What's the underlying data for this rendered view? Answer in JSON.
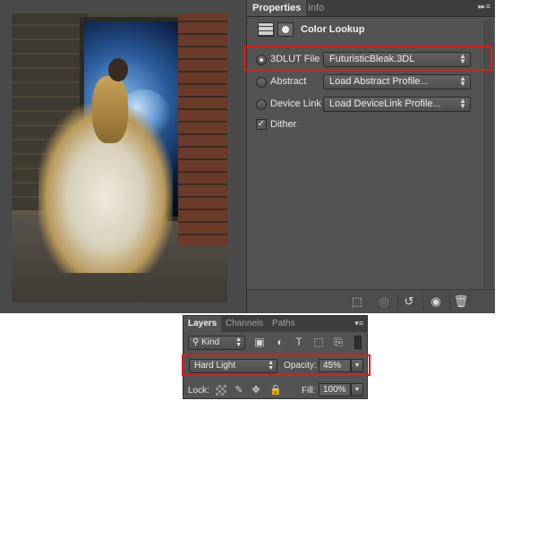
{
  "properties_panel": {
    "tabs": [
      "Properties",
      "Info"
    ],
    "menu_icon": "panel-menu-icon",
    "header_icons": [
      "adjustment-grid-icon",
      "layer-mask-icon"
    ],
    "title": "Color Lookup",
    "options": [
      {
        "label": "3DLUT File",
        "selected": true,
        "value": "FuturisticBleak.3DL"
      },
      {
        "label": "Abstract",
        "selected": false,
        "value": "Load Abstract Profile..."
      },
      {
        "label": "Device Link",
        "selected": false,
        "value": "Load DeviceLink Profile..."
      }
    ],
    "dither": {
      "label": "Dither",
      "checked": true
    },
    "bottom_icons": [
      "clip-to-layer-icon",
      "view-previous-icon",
      "reset-icon",
      "visibility-eye-icon",
      "trash-icon"
    ]
  },
  "layers_panel": {
    "tabs": [
      "Layers",
      "Channels",
      "Paths"
    ],
    "filter_kind": "Kind",
    "filter_icons": [
      "pixel-filter-icon",
      "adjustment-filter-icon",
      "type-filter-icon",
      "shape-filter-icon",
      "smart-object-filter-icon"
    ],
    "blend_mode": "Hard Light",
    "opacity_label": "Opacity:",
    "opacity_value": "45%",
    "lock_label": "Lock:",
    "lock_icons": [
      "lock-transparency-icon",
      "lock-pixels-icon",
      "lock-position-icon",
      "lock-all-icon"
    ],
    "fill_label": "Fill:",
    "fill_value": "100%"
  },
  "highlight_color": "#d81e1e"
}
